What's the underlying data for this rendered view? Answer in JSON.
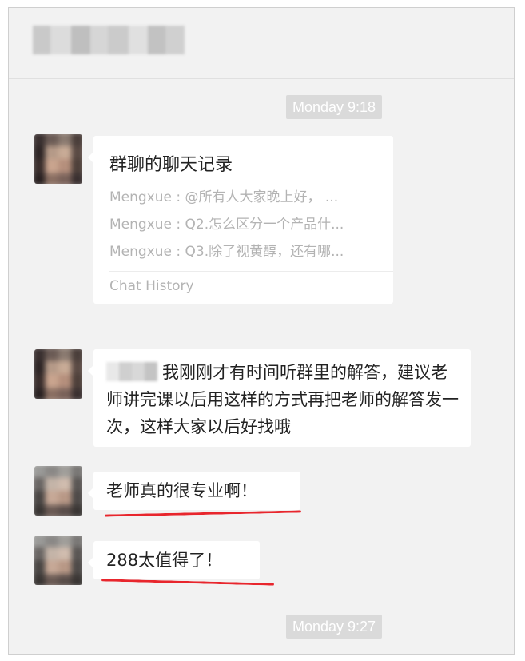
{
  "header": {
    "title_mosaic_colors": [
      "#c9c9c9",
      "#dcdcdc",
      "#bfbfbf",
      "#d6d6d6",
      "#cbcbcb",
      "#e0e0e0",
      "#c2c2c2",
      "#d0d0d0"
    ]
  },
  "timestamps": [
    "Monday 9:18",
    "Monday 9:27"
  ],
  "chat_record": {
    "title": "群聊的聊天记录",
    "lines": [
      "Mengxue : @所有人大家晚上好，  ...",
      "Mengxue : Q2.怎么区分一个产品什...",
      "Mengxue : Q3.除了视黄醇，还有哪..."
    ],
    "footer": "Chat History"
  },
  "messages": [
    {
      "text": "我刚刚才有时间听群里的解答，建议老师讲完课以后用这样的方式再把老师的解答发一次，这样大家以后好找哦"
    },
    {
      "text": "老师真的很专业啊！"
    },
    {
      "text": "288太值得了！"
    }
  ],
  "colors": {
    "underline": "#e8262d",
    "timestamp_bg": "#dadada",
    "chat_bg": "#f2f2f2"
  }
}
